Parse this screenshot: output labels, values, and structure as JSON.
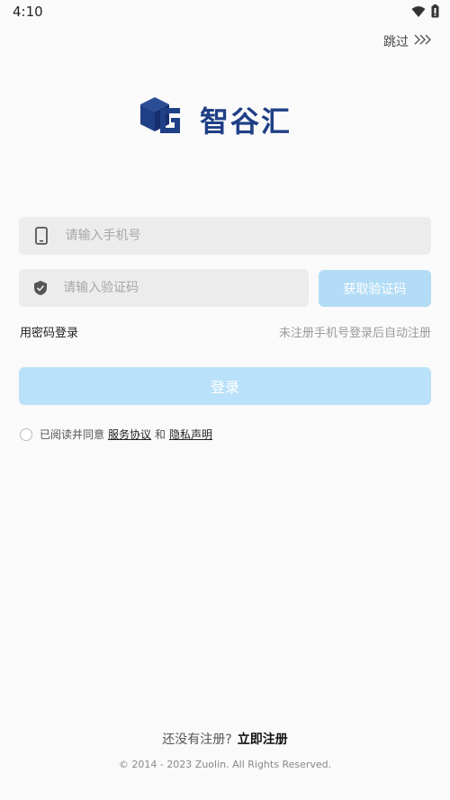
{
  "status": {
    "time": "4:10"
  },
  "header": {
    "skip_label": "跳过"
  },
  "logo": {
    "text": "智谷汇",
    "brand_color": "#1f3f86"
  },
  "form": {
    "phone_placeholder": "请输入手机号",
    "phone_value": "",
    "code_placeholder": "请输入验证码",
    "code_value": "",
    "get_code_label": "获取验证码",
    "password_login_label": "用密码登录",
    "auto_register_hint": "未注册手机号登录后自动注册",
    "login_label": "登录"
  },
  "agreement": {
    "prefix": "已阅读并同意",
    "service_link": "服务协议",
    "and": "和",
    "privacy_link": "隐私声明"
  },
  "footer": {
    "no_account": "还没有注册?",
    "register_now": "立即注册",
    "copyright": "© 2014 - 2023 Zuolin. All Rights Reserved."
  },
  "colors": {
    "accent_light": "#b9e1f9",
    "field_bg": "#ececec"
  }
}
